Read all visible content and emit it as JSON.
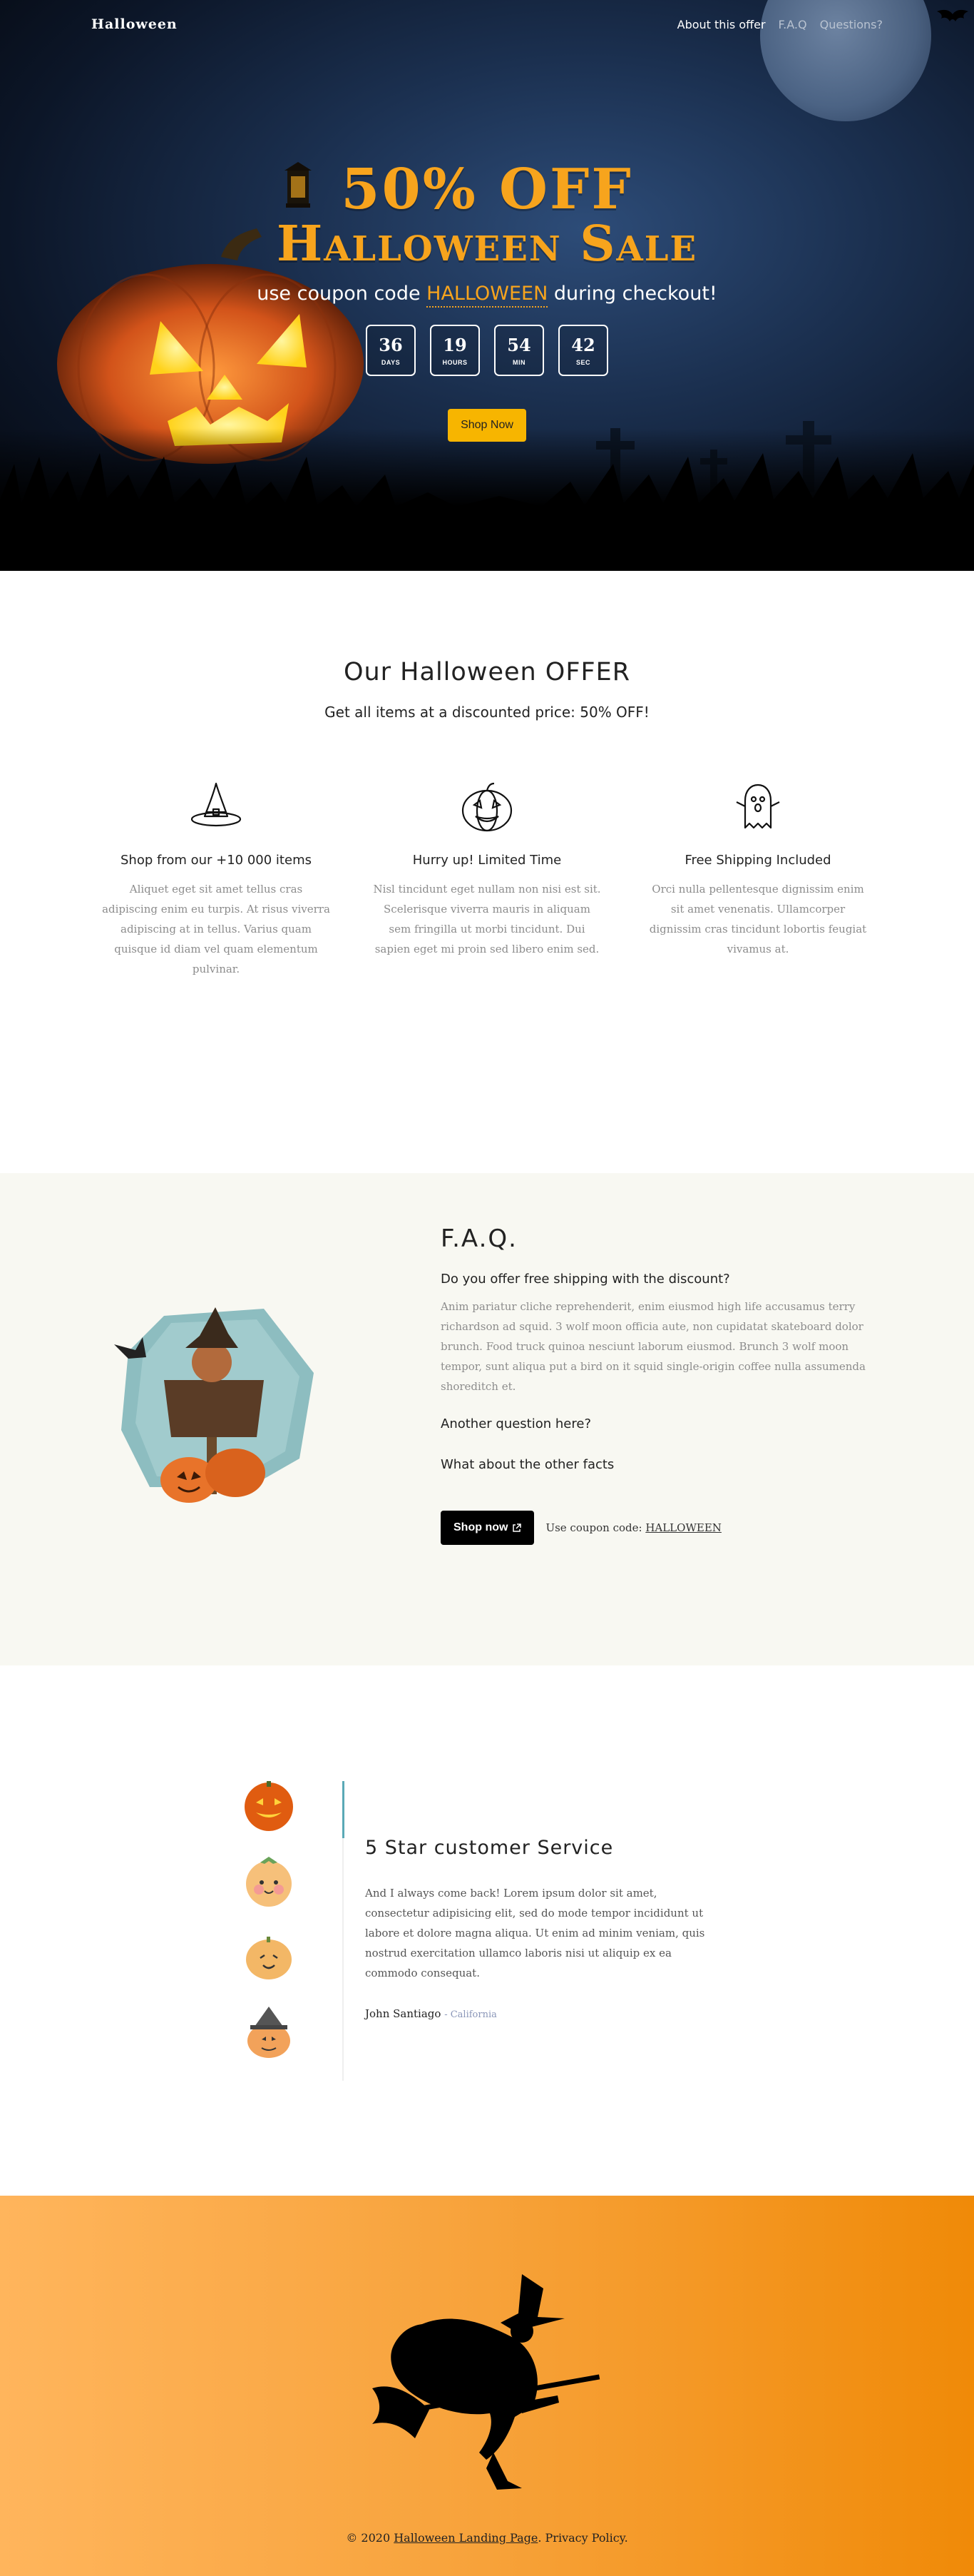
{
  "nav": {
    "brand": "Halloween",
    "links": [
      "About this offer",
      "F.A.Q",
      "Questions?"
    ]
  },
  "hero": {
    "title_line1": "50% OFF",
    "title_line2": "Halloween Sale",
    "coupon_prefix": "use coupon code ",
    "coupon_code": "HALLOWEEN",
    "coupon_suffix": " during checkout!",
    "countdown": [
      {
        "value": "36",
        "label": "DAYS"
      },
      {
        "value": "19",
        "label": "HOURS"
      },
      {
        "value": "54",
        "label": "MIN"
      },
      {
        "value": "42",
        "label": "SEC"
      }
    ],
    "button": "Shop Now"
  },
  "offer": {
    "title": "Our Halloween OFFER",
    "subtitle": "Get all items at a discounted price: 50% OFF!",
    "features": [
      {
        "icon": "witch-hat-icon",
        "title": "Shop from our +10 000 items",
        "text": "Aliquet eget sit amet tellus cras adipiscing enim eu turpis. At risus viverra adipiscing at in tellus. Varius quam quisque id diam vel quam elementum pulvinar."
      },
      {
        "icon": "jack-o-lantern-icon",
        "title": "Hurry up! Limited Time",
        "text": "Nisl tincidunt eget nullam non nisi est sit. Scelerisque viverra mauris in aliquam sem fringilla ut morbi tincidunt. Dui sapien eget mi proin sed libero enim sed."
      },
      {
        "icon": "ghost-icon",
        "title": "Free Shipping Included",
        "text": "Orci nulla pellentesque dignissim enim sit amet venenatis. Ullamcorper dignissim cras tincidunt lobortis feugiat vivamus at."
      }
    ]
  },
  "faq": {
    "title": "F.A.Q.",
    "q1": "Do you offer free shipping with the discount?",
    "a1": "Anim pariatur cliche reprehenderit, enim eiusmod high life accusamus terry richardson ad squid. 3 wolf moon officia aute, non cupidatat skateboard dolor brunch. Food truck quinoa nesciunt laborum eiusmod. Brunch 3 wolf moon tempor, sunt aliqua put a bird on it squid single-origin coffee nulla assumenda shoreditch et.",
    "q2": "Another question here?",
    "q3": "What about the other facts",
    "button": "Shop now",
    "coupon_label": "Use coupon code: ",
    "coupon_code": "HALLOWEEN"
  },
  "testimonial": {
    "title": "5 Star customer Service",
    "text": "And I always come back! Lorem ipsum dolor sit amet, consectetur adipisicing elit, sed do mode tempor incididunt ut labore et dolore magna aliqua. Ut enim ad minim veniam, quis nostrud exercitation ullamco laboris nisi ut aliquip ex ea commodo consequat.",
    "author": "John Santiago",
    "location": "California"
  },
  "footer": {
    "prefix": "© 2020 ",
    "link": "Halloween Landing Page",
    "suffix": ". Privacy Policy."
  },
  "colors": {
    "accent": "#f7a41d",
    "button_yellow": "#f7b500",
    "faq_bg": "#f8f8f2",
    "footer_orange": "#f08a08",
    "teal": "#5aa9b6"
  }
}
